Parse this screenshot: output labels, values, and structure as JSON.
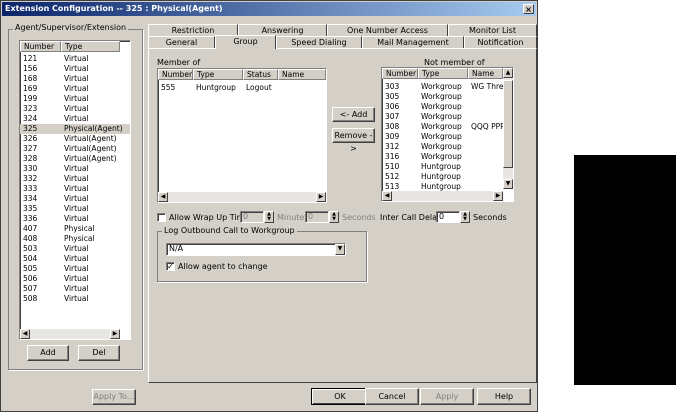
{
  "window": {
    "title": "Extension Configuration -- 325 : Physical(Agent)",
    "close": "×"
  },
  "left_panel": {
    "label": "Agent/Supervisor/Extension",
    "columns": [
      "Number",
      "Type"
    ],
    "rows": [
      [
        "121",
        "Virtual"
      ],
      [
        "156",
        "Virtual"
      ],
      [
        "168",
        "Virtual"
      ],
      [
        "169",
        "Virtual"
      ],
      [
        "199",
        "Virtual"
      ],
      [
        "323",
        "Virtual"
      ],
      [
        "324",
        "Virtual"
      ],
      [
        "325",
        "Physical(Agent)"
      ],
      [
        "326",
        "Virtual(Agent)"
      ],
      [
        "327",
        "Virtual(Agent)"
      ],
      [
        "328",
        "Virtual(Agent)"
      ],
      [
        "330",
        "Virtual"
      ],
      [
        "332",
        "Virtual"
      ],
      [
        "333",
        "Virtual"
      ],
      [
        "334",
        "Virtual"
      ],
      [
        "335",
        "Virtual"
      ],
      [
        "336",
        "Virtual"
      ],
      [
        "407",
        "Physical"
      ],
      [
        "408",
        "Physical"
      ],
      [
        "503",
        "Virtual"
      ],
      [
        "504",
        "Virtual"
      ],
      [
        "505",
        "Virtual"
      ],
      [
        "506",
        "Virtual"
      ],
      [
        "507",
        "Virtual"
      ],
      [
        "508",
        "Virtual"
      ]
    ],
    "selected_index": 7,
    "add_label": "Add",
    "del_label": "Del"
  },
  "tabs": {
    "row1": [
      "Restriction",
      "Answering",
      "One Number Access",
      "Monitor List"
    ],
    "row2": [
      "General",
      "Group",
      "Speed Dialing",
      "Mail Management",
      "Notification"
    ],
    "active": "Group"
  },
  "member_of": {
    "label": "Member of",
    "columns": [
      "Number",
      "Type",
      "Status",
      "Name"
    ],
    "rows": [
      [
        "555",
        "Huntgroup",
        "Logout",
        ""
      ]
    ]
  },
  "buttons": {
    "add": "<- Add",
    "remove": "Remove ->"
  },
  "not_member_of": {
    "label": "Not member of",
    "columns": [
      "Number",
      "Type",
      "Name"
    ],
    "rows": [
      [
        "303",
        "Workgroup",
        "WG Thre"
      ],
      [
        "305",
        "Workgroup",
        ""
      ],
      [
        "306",
        "Workgroup",
        ""
      ],
      [
        "307",
        "Workgroup",
        ""
      ],
      [
        "308",
        "Workgroup",
        "QQQ PPP"
      ],
      [
        "309",
        "Workgroup",
        ""
      ],
      [
        "312",
        "Workgroup",
        ""
      ],
      [
        "316",
        "Workgroup",
        ""
      ],
      [
        "510",
        "Huntgroup",
        ""
      ],
      [
        "512",
        "Huntgroup",
        ""
      ],
      [
        "513",
        "Huntgroup",
        ""
      ]
    ]
  },
  "wrapup": {
    "checkbox_label": "Allow Wrap Up Time",
    "minutes_value": "0",
    "minutes_label": "Minutes",
    "seconds_value": "0",
    "seconds_label": "Seconds",
    "inter_call_label": "Inter Call Delay",
    "inter_call_value": "0",
    "inter_call_seconds": "Seconds"
  },
  "log_outbound": {
    "label": "Log Outbound Call to Workgroup",
    "selected": "N/A",
    "allow_label": "Allow agent to change",
    "allow_checked": "✓"
  },
  "footer": {
    "apply_to": "Apply To...",
    "ok": "OK",
    "cancel": "Cancel",
    "apply": "Apply",
    "help": "Help"
  }
}
